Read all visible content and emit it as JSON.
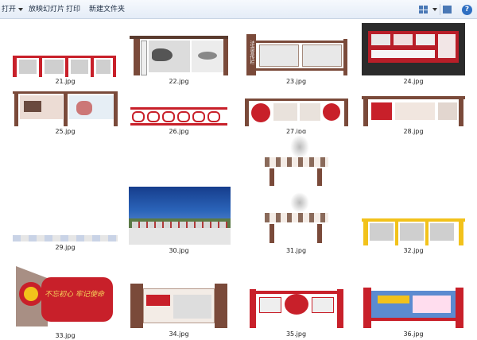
{
  "toolbar": {
    "open_label": "打开",
    "slideshow_label": "放映幻灯片",
    "print_label": "打印",
    "new_folder_label": "新建文件夹"
  },
  "files": [
    {
      "name": "21.jpg"
    },
    {
      "name": "22.jpg"
    },
    {
      "name": "23.jpg"
    },
    {
      "name": "24.jpg"
    },
    {
      "name": "25.jpg"
    },
    {
      "name": "26.jpg"
    },
    {
      "name": "27.jpg"
    },
    {
      "name": "28.jpg"
    },
    {
      "name": "29.jpg"
    },
    {
      "name": "30.jpg"
    },
    {
      "name": "31.jpg"
    },
    {
      "name": "32.jpg"
    },
    {
      "name": "33.jpg"
    },
    {
      "name": "34.jpg"
    },
    {
      "name": "35.jpg"
    },
    {
      "name": "36.jpg"
    }
  ],
  "thumb_texts": {
    "t23_sign": "法治宣传栏",
    "t33_slogan": "不忘初心 牢记使命"
  },
  "colors": {
    "brand_red": "#c8202a",
    "brown": "#7a4a3a",
    "gold": "#f2c21b",
    "dark_bg": "#2b2b2b",
    "sky_blue": "#2a63b8"
  },
  "icons": {
    "view": "view-options-icon",
    "help": "help-icon"
  }
}
